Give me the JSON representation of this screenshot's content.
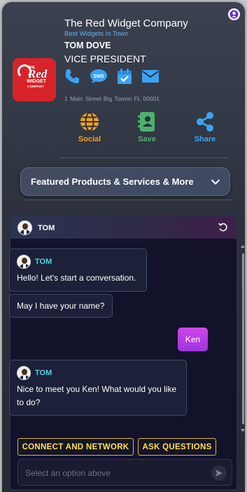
{
  "company": {
    "name": "The Red Widget Company",
    "tagline": "Best Widgets In Town",
    "logo": {
      "the": "THE",
      "red": "Red",
      "widget": "WIDGET",
      "company": "COMPANY"
    }
  },
  "person": {
    "name": "TOM DOVE",
    "title": "VICE PRESIDENT"
  },
  "contact": {
    "icons": [
      "phone-icon",
      "sms-icon",
      "calendar-icon",
      "email-icon"
    ],
    "sms_text": "SMS",
    "address": "1 Main Street  Big Townn  FL  00001"
  },
  "actions": [
    {
      "label": "Social",
      "icon": "globe-icon",
      "color": "#f3a221"
    },
    {
      "label": "Save",
      "icon": "contact-book-icon",
      "color": "#4bb26c"
    },
    {
      "label": "Share",
      "icon": "share-icon",
      "color": "#3aa3f5"
    }
  ],
  "featured": {
    "label": "Featured Products & Services & More"
  },
  "chat": {
    "agent_name": "TOM",
    "messages": [
      {
        "sender": "TOM",
        "text": "Hello! Let's start a conversation."
      },
      {
        "text": "May I have your name?"
      },
      {
        "sender": "user",
        "text": "Ken"
      },
      {
        "sender": "TOM",
        "text": "Nice to meet you Ken!  What would you like to do?"
      }
    ],
    "options": [
      "CONNECT AND NETWORK",
      "ASK QUESTIONS"
    ],
    "input_placeholder": "Select an option above"
  },
  "colors": {
    "accent_blue": "#3aa3f5",
    "tagline": "#5db7f0",
    "user_bubble": "#c541e6",
    "option_yellow": "#ffe14a",
    "agent_name": "#4dd3e6"
  }
}
